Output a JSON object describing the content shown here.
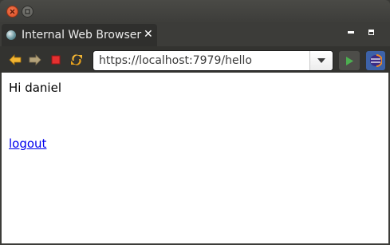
{
  "window": {
    "close_icon": "close-icon",
    "minimize_icon": "minimize-icon"
  },
  "tab": {
    "title": "Internal Web Browser",
    "close_label": "✕",
    "icon": "globe-icon"
  },
  "toolbar": {
    "back_icon": "back-arrow-icon",
    "forward_icon": "forward-arrow-icon",
    "stop_icon": "stop-icon",
    "refresh_icon": "refresh-icon",
    "url": "https://localhost:7979/hello",
    "dropdown_icon": "chevron-down-icon",
    "go_icon": "go-play-icon",
    "eclipse_icon": "eclipse-icon"
  },
  "page": {
    "greeting": "Hi daniel",
    "logout_link": "logout"
  },
  "colors": {
    "close_button": "#e0531f",
    "link": "#0000ee",
    "go_arrow": "#4caf50",
    "stop": "#e53030",
    "nav_arrow": "#f2b533"
  }
}
